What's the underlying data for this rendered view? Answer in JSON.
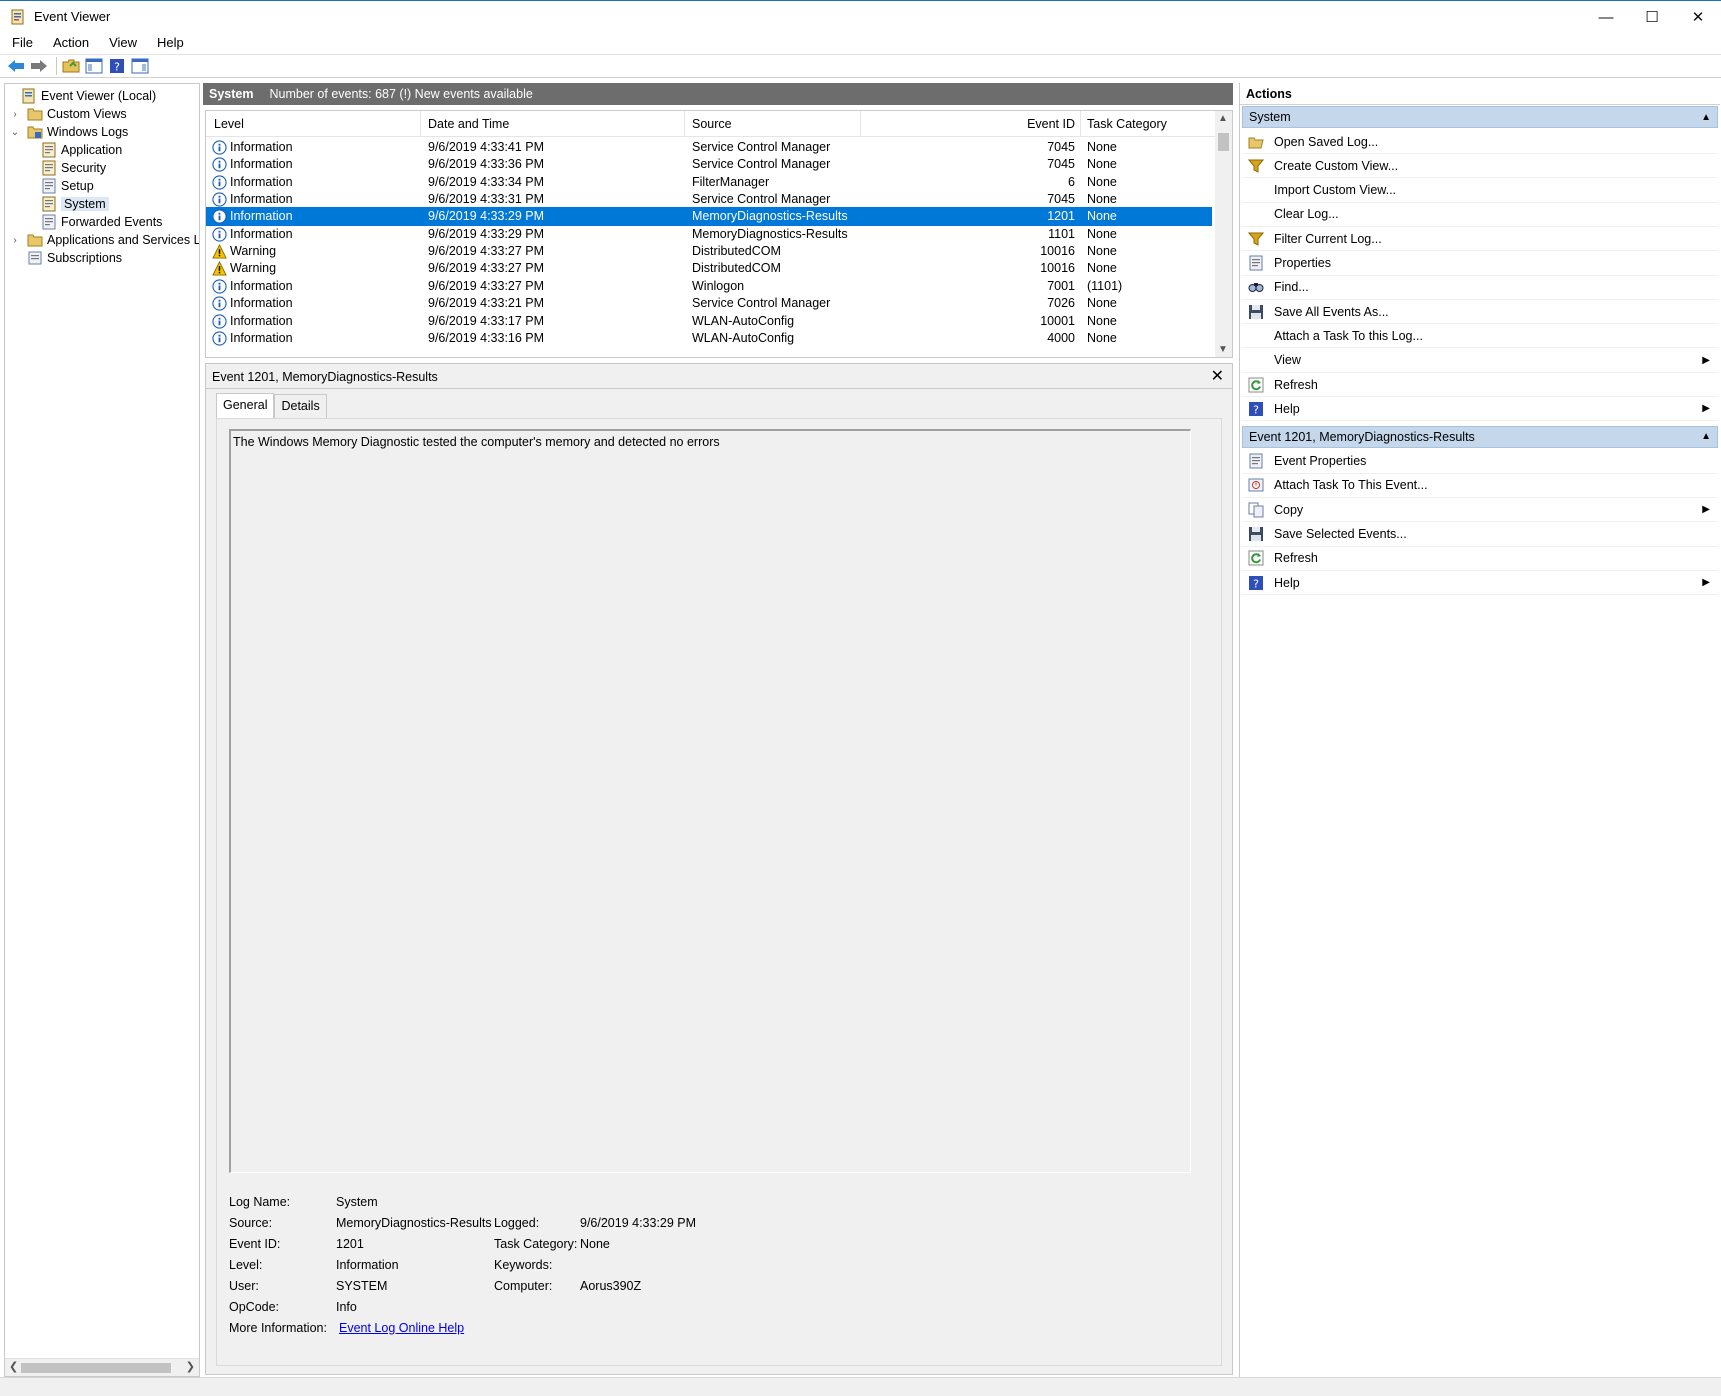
{
  "window": {
    "title": "Event Viewer",
    "controls": {
      "minimize": "—",
      "maximize": "☐",
      "close": "✕"
    }
  },
  "menu": [
    "File",
    "Action",
    "View",
    "Help"
  ],
  "toolbar": {
    "icons": [
      "back-icon",
      "forward-icon",
      "open-folder-icon",
      "show-hide-tree-icon",
      "help-icon",
      "show-hide-action-pane-icon"
    ]
  },
  "tree": {
    "items": [
      {
        "label": "Event Viewer (Local)",
        "icon": "event-viewer-icon",
        "expander": ""
      },
      {
        "label": "Custom Views",
        "icon": "folder-icon",
        "expander": "›"
      },
      {
        "label": "Windows Logs",
        "icon": "folder-icon",
        "expander": "⌄"
      },
      {
        "label": "Application",
        "icon": "log-icon",
        "expander": ""
      },
      {
        "label": "Security",
        "icon": "log-icon",
        "expander": ""
      },
      {
        "label": "Setup",
        "icon": "log-icon",
        "expander": ""
      },
      {
        "label": "System",
        "icon": "log-icon",
        "expander": ""
      },
      {
        "label": "Forwarded Events",
        "icon": "log-icon",
        "expander": ""
      },
      {
        "label": "Applications and Services Lo",
        "icon": "folder-icon",
        "expander": "›"
      },
      {
        "label": "Subscriptions",
        "icon": "subscriptions-icon",
        "expander": ""
      }
    ],
    "selected_index": 6
  },
  "center": {
    "log_name": "System",
    "summary": "Number of events: 687 (!) New events available"
  },
  "grid": {
    "columns": [
      "Level",
      "Date and Time",
      "Source",
      "Event ID",
      "Task Category"
    ],
    "rows": [
      {
        "level": "Information",
        "icon": "info-icon",
        "date": "9/6/2019 4:33:41 PM",
        "source": "Service Control Manager",
        "event_id": "7045",
        "task": "None"
      },
      {
        "level": "Information",
        "icon": "info-icon",
        "date": "9/6/2019 4:33:36 PM",
        "source": "Service Control Manager",
        "event_id": "7045",
        "task": "None"
      },
      {
        "level": "Information",
        "icon": "info-icon",
        "date": "9/6/2019 4:33:34 PM",
        "source": "FilterManager",
        "event_id": "6",
        "task": "None"
      },
      {
        "level": "Information",
        "icon": "info-icon",
        "date": "9/6/2019 4:33:31 PM",
        "source": "Service Control Manager",
        "event_id": "7045",
        "task": "None"
      },
      {
        "level": "Information",
        "icon": "info-icon",
        "date": "9/6/2019 4:33:29 PM",
        "source": "MemoryDiagnostics-Results",
        "event_id": "1201",
        "task": "None"
      },
      {
        "level": "Information",
        "icon": "info-icon",
        "date": "9/6/2019 4:33:29 PM",
        "source": "MemoryDiagnostics-Results",
        "event_id": "1101",
        "task": "None"
      },
      {
        "level": "Warning",
        "icon": "warning-icon",
        "date": "9/6/2019 4:33:27 PM",
        "source": "DistributedCOM",
        "event_id": "10016",
        "task": "None"
      },
      {
        "level": "Warning",
        "icon": "warning-icon",
        "date": "9/6/2019 4:33:27 PM",
        "source": "DistributedCOM",
        "event_id": "10016",
        "task": "None"
      },
      {
        "level": "Information",
        "icon": "info-icon",
        "date": "9/6/2019 4:33:27 PM",
        "source": "Winlogon",
        "event_id": "7001",
        "task": "(1101)"
      },
      {
        "level": "Information",
        "icon": "info-icon",
        "date": "9/6/2019 4:33:21 PM",
        "source": "Service Control Manager",
        "event_id": "7026",
        "task": "None"
      },
      {
        "level": "Information",
        "icon": "info-icon",
        "date": "9/6/2019 4:33:17 PM",
        "source": "WLAN-AutoConfig",
        "event_id": "10001",
        "task": "None"
      },
      {
        "level": "Information",
        "icon": "info-icon",
        "date": "9/6/2019 4:33:16 PM",
        "source": "WLAN-AutoConfig",
        "event_id": "4000",
        "task": "None"
      }
    ],
    "selected_index": 4
  },
  "detail": {
    "title": "Event 1201, MemoryDiagnostics-Results",
    "close": "✕",
    "tabs": [
      "General",
      "Details"
    ],
    "active_tab": 0,
    "description": "The Windows Memory Diagnostic tested the computer's memory and detected no errors",
    "fields": {
      "log_name_label": "Log Name:",
      "log_name": "System",
      "source_label": "Source:",
      "source": "MemoryDiagnostics-Results",
      "logged_label": "Logged:",
      "logged": "9/6/2019 4:33:29 PM",
      "event_id_label": "Event ID:",
      "event_id": "1201",
      "task_category_label": "Task Category:",
      "task_category": "None",
      "level_label": "Level:",
      "level": "Information",
      "keywords_label": "Keywords:",
      "keywords": "",
      "user_label": "User:",
      "user": "SYSTEM",
      "computer_label": "Computer:",
      "computer": "Aorus390Z",
      "opcode_label": "OpCode:",
      "opcode": "Info",
      "more_info_label": "More Information:",
      "more_info_link": "Event Log Online Help"
    }
  },
  "actions": {
    "header": "Actions",
    "sections": [
      {
        "title": "System",
        "items": [
          {
            "label": "Open Saved Log...",
            "icon": "open-log-icon",
            "submenu": false
          },
          {
            "label": "Create Custom View...",
            "icon": "filter-icon",
            "submenu": false
          },
          {
            "label": "Import Custom View...",
            "icon": "",
            "submenu": false
          },
          {
            "label": "Clear Log...",
            "icon": "",
            "submenu": false
          },
          {
            "label": "Filter Current Log...",
            "icon": "filter-icon",
            "submenu": false
          },
          {
            "label": "Properties",
            "icon": "properties-icon",
            "submenu": false
          },
          {
            "label": "Find...",
            "icon": "find-icon",
            "submenu": false
          },
          {
            "label": "Save All Events As...",
            "icon": "save-icon",
            "submenu": false
          },
          {
            "label": "Attach a Task To this Log...",
            "icon": "",
            "submenu": false
          },
          {
            "label": "View",
            "icon": "",
            "submenu": true
          },
          {
            "label": "Refresh",
            "icon": "refresh-icon",
            "submenu": false
          },
          {
            "label": "Help",
            "icon": "help-icon",
            "submenu": true
          }
        ]
      },
      {
        "title": "Event 1201, MemoryDiagnostics-Results",
        "items": [
          {
            "label": "Event Properties",
            "icon": "properties-icon",
            "submenu": false
          },
          {
            "label": "Attach Task To This Event...",
            "icon": "task-icon",
            "submenu": false
          },
          {
            "label": "Copy",
            "icon": "copy-icon",
            "submenu": true
          },
          {
            "label": "Save Selected Events...",
            "icon": "save-icon",
            "submenu": false
          },
          {
            "label": "Refresh",
            "icon": "refresh-icon",
            "submenu": false
          },
          {
            "label": "Help",
            "icon": "help-icon",
            "submenu": true
          }
        ]
      }
    ]
  },
  "colors": {
    "selection": "#0078d7",
    "section_header": "#c5d7ea",
    "center_header": "#6d6d6d"
  }
}
